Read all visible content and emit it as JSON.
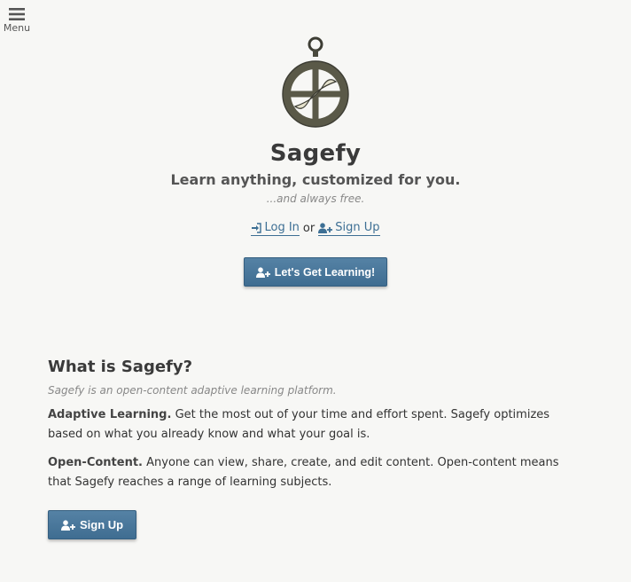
{
  "menu": {
    "label": "Menu",
    "icon": "hamburger-icon"
  },
  "hero": {
    "logo_icon": "armillary-compass-icon",
    "brand": "Sagefy",
    "tagline": "Learn anything, customized for you.",
    "free_note": "...and always free.",
    "login_label": "Log In",
    "or_text": "or",
    "signup_label": "Sign Up",
    "cta_label": "Let's Get Learning!"
  },
  "about": {
    "title": "What is Sagefy?",
    "lead": "Sagefy is an open-content adaptive learning platform.",
    "features": [
      {
        "name": "Adaptive Learning.",
        "text": "Get the most out of your time and effort spent. Sagefy optimizes based on what you already know and what your goal is."
      },
      {
        "name": "Open-Content.",
        "text": "Anyone can view, share, create, and edit content. Open-content means that Sagefy reaches a range of learning subjects."
      }
    ],
    "signup_label": "Sign Up"
  },
  "colors": {
    "background": "#f7f7f5",
    "accent": "#3f6d91",
    "link": "#3d6f94",
    "logo": "#6b6a55"
  }
}
